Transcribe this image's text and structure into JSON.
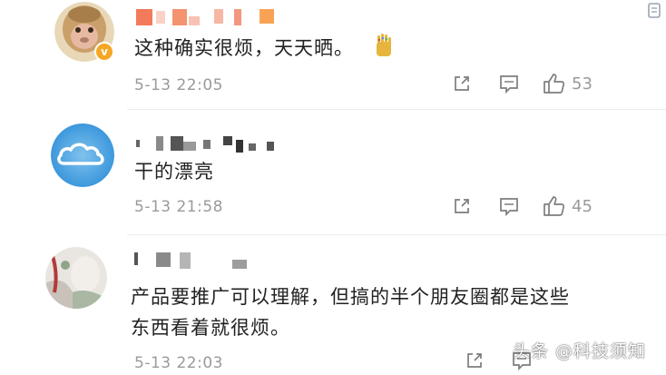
{
  "comments": [
    {
      "avatar": "monkey-avatar",
      "verified": true,
      "name_hidden": true,
      "text": "这种确实很烦，天天晒。",
      "emoji": "gold-gauntlet-emoji",
      "time": "5-13 22:05",
      "likes": "53"
    },
    {
      "avatar": "cloud-avatar",
      "verified": false,
      "name_hidden": true,
      "text": "干的漂亮",
      "time": "5-13 21:58",
      "likes": "45"
    },
    {
      "avatar": "photo-avatar",
      "verified": false,
      "name_hidden": true,
      "text_line1": "产品要推广可以理解，但搞的半个朋友圈都是这些",
      "text_line2": "东西看着就很烦。",
      "time": "5-13 22:03",
      "likes": ""
    }
  ],
  "watermark": "头条 @科技须知",
  "icons": [
    "share-icon",
    "comment-icon",
    "like-icon"
  ],
  "colors": {
    "meta": "#9a9a9a",
    "text": "#222222",
    "badge": "#f5a623",
    "watermark_shadow": "#000000"
  }
}
